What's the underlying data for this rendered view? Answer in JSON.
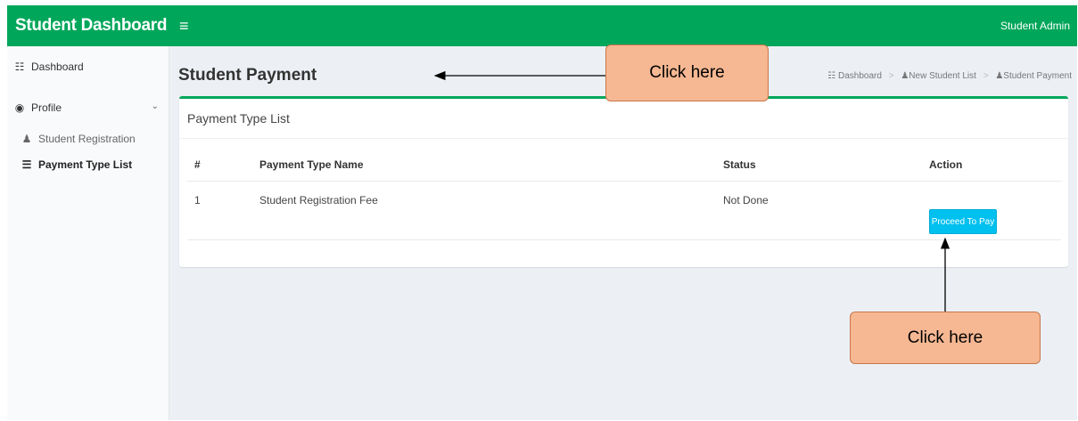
{
  "app": {
    "title": "Student Dashboard",
    "menu_icon": "hamburger-icon",
    "user_label": "Student Admin"
  },
  "colors": {
    "header": "#00a65a",
    "button": "#00c0ef",
    "callout": "#f6b893",
    "background": "#ecf0f5"
  },
  "sidebar": {
    "items": [
      {
        "label": "Dashboard",
        "icon": "dashboard-icon"
      },
      {
        "label": "Profile",
        "icon": "eye-icon",
        "expand_icon": "chevron-down-icon"
      },
      {
        "label": "Student Registration",
        "icon": "user-icon"
      },
      {
        "label": "Payment Type List",
        "icon": "list-icon",
        "active": true
      }
    ]
  },
  "page": {
    "title": "Student Payment",
    "breadcrumb": [
      "Dashboard",
      "New Student List",
      "Student Payment"
    ]
  },
  "box": {
    "title": "Payment Type List",
    "columns": [
      "#",
      "Payment Type Name",
      "Status",
      "Action"
    ],
    "rows": [
      {
        "num": "1",
        "name": "Student Registration Fee",
        "status": "Not Done",
        "action": "Proceed To Pay"
      }
    ]
  },
  "annotations": {
    "callout_1": "Click here",
    "callout_2": "Click here"
  }
}
